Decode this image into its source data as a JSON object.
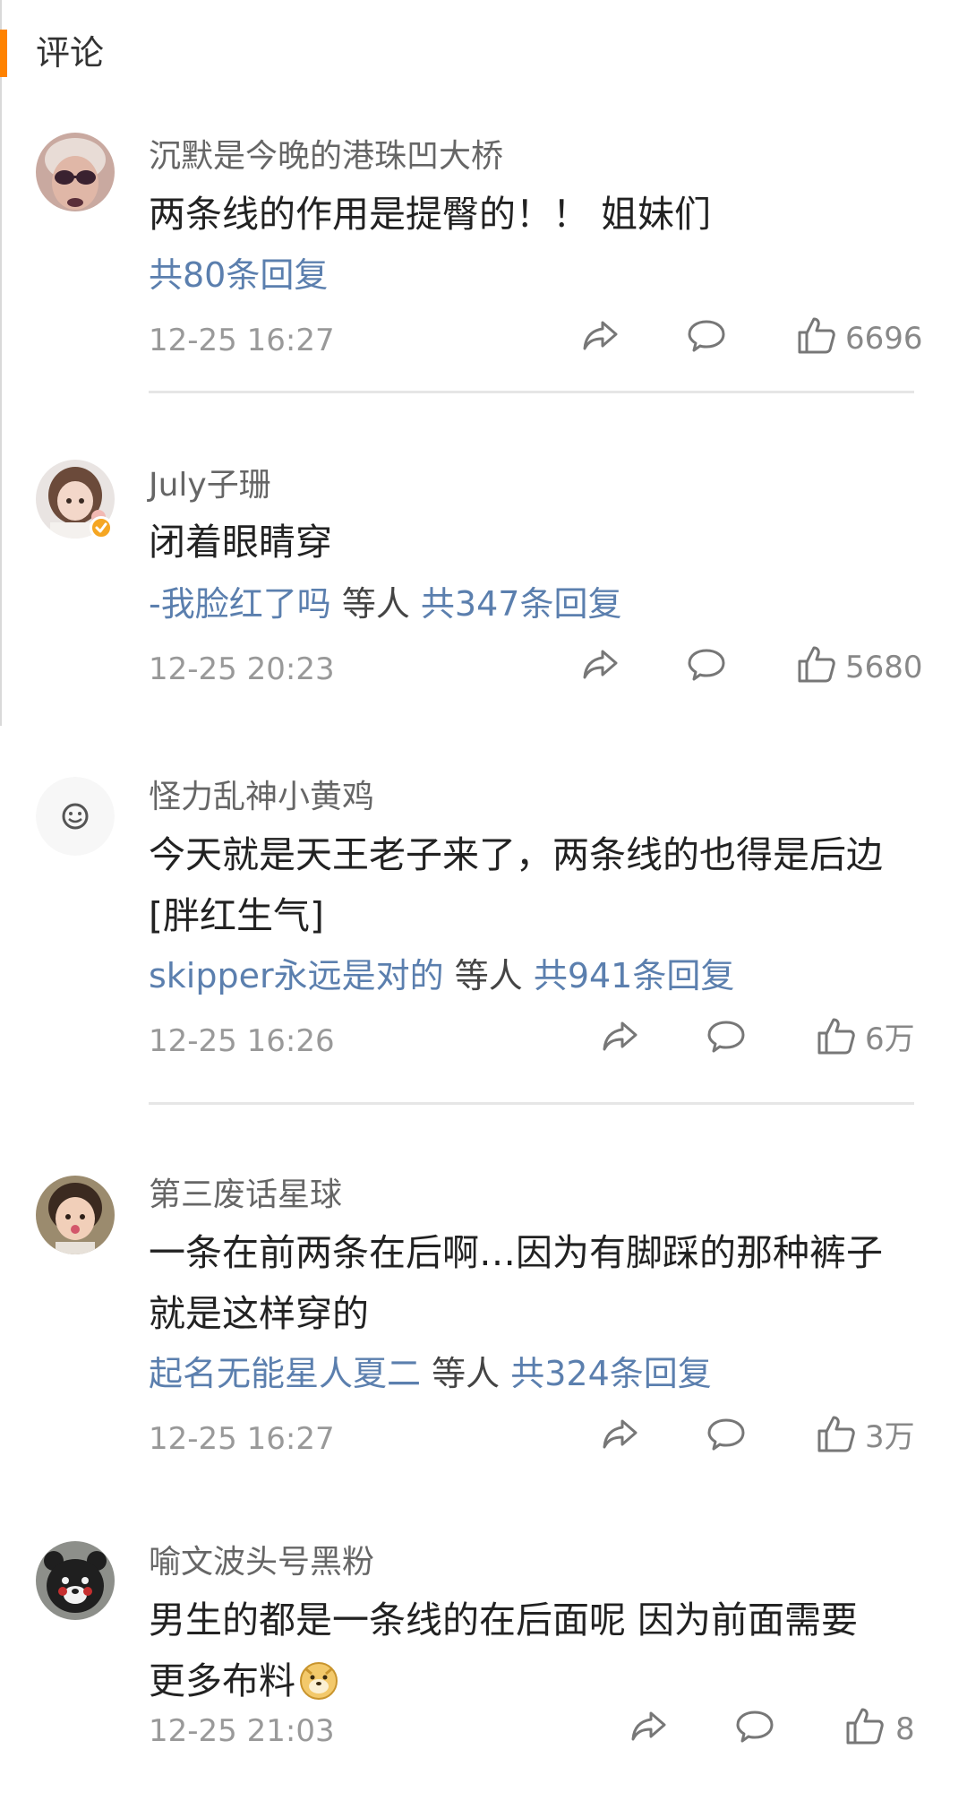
{
  "section": {
    "title": "评论"
  },
  "comments": [
    {
      "username": "沉默是今晚的港珠凹大桥",
      "text": "两条线的作用是提臀的！！ 姐妹们",
      "replier": "",
      "others": "",
      "reply_count": "共80条回复",
      "time": "12-25 16:27",
      "likes": "6696"
    },
    {
      "username": "July子珊",
      "text": "闭着眼睛穿",
      "replier": "-我脸红了吗",
      "others": "等人",
      "reply_count": "共347条回复",
      "time": "12-25 20:23",
      "likes": "5680",
      "verified": true
    },
    {
      "username": "怪力乱神小黄鸡",
      "text": "今天就是天王老子来了，两条线的也得是后边[胖红生气]",
      "replier": "skipper永远是对的",
      "others": "等人",
      "reply_count": "共941条回复",
      "time": "12-25 16:26",
      "likes": "6万"
    },
    {
      "username": "第三废话星球",
      "text": "一条在前两条在后啊…因为有脚踩的那种裤子就是这样穿的",
      "replier": "起名无能星人夏二",
      "others": "等人",
      "reply_count": "共324条回复",
      "time": "12-25 16:27",
      "likes": "3万"
    },
    {
      "username": "喻文波头号黑粉",
      "text": "男生的都是一条线的在后面呢 因为前面需要更多布料",
      "replier": "",
      "others": "",
      "reply_count": "",
      "time": "12-25 21:03",
      "likes": "8",
      "emoji": "doge"
    }
  ],
  "colors": {
    "accent": "#ff8200",
    "link": "#5b7fae",
    "meta": "#999999",
    "text": "#222222",
    "divider": "#e6e6e6",
    "verified": "#f5a623"
  },
  "icons": {
    "share": "share-icon",
    "comment": "comment-icon",
    "like": "thumbs-up-icon"
  }
}
